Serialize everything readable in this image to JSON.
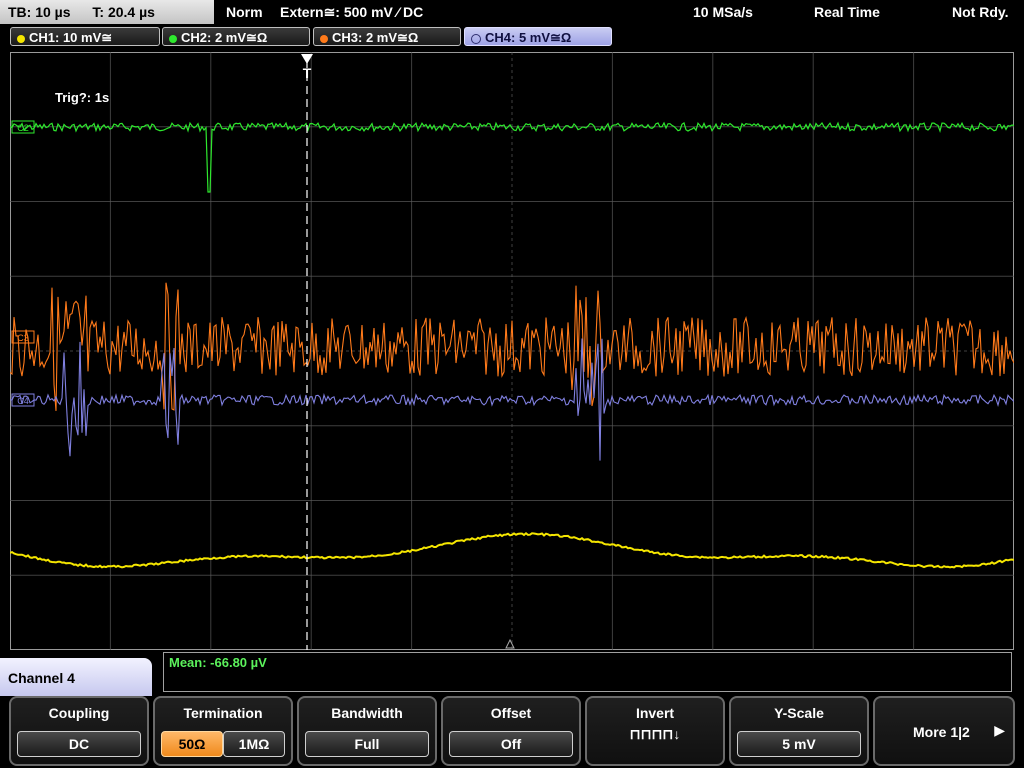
{
  "topbar": {
    "timebase": "TB: 10 µs",
    "trigger_time": "T: 20.4 µs",
    "mode": "Norm",
    "trigger_source": "Extern≅: 500 mV ⁄ DC",
    "sample_rate": "10 MSa/s",
    "acq_mode": "Real Time",
    "status": "Not Rdy."
  },
  "channels": [
    {
      "label": "CH1: 10 mV≅",
      "color": "#f5e600",
      "active": false
    },
    {
      "label": "CH2: 2 mV≅Ω",
      "color": "#2ee82e",
      "active": false
    },
    {
      "label": "CH3: 2 mV≅Ω",
      "color": "#ff7a1a",
      "active": false
    },
    {
      "label": "CH4: 5 mV≅Ω",
      "color": "#8080e0",
      "active": true
    }
  ],
  "screen": {
    "trigger_status": "Trig?: 1s",
    "trigger_marker": "T"
  },
  "measurement": {
    "text": "Mean: -66.80 µV"
  },
  "menu": {
    "channel_title": "Channel 4",
    "softkeys": {
      "coupling": {
        "title": "Coupling",
        "value": "DC"
      },
      "termination": {
        "title": "Termination",
        "option_a": "50Ω",
        "option_b": "1MΩ",
        "selected": "50Ω"
      },
      "bandwidth": {
        "title": "Bandwidth",
        "value": "Full"
      },
      "offset": {
        "title": "Offset",
        "value": "Off"
      },
      "invert": {
        "title": "Invert",
        "glyph": "⊓⊓⊓⊓↓"
      },
      "yscale": {
        "title": "Y-Scale",
        "value": "5 mV"
      },
      "more": {
        "label": "More 1|2",
        "arrow": "▶"
      }
    }
  },
  "colors": {
    "ch1": "#f5e600",
    "ch2": "#2ee82e",
    "ch3": "#ff7a1a",
    "ch4": "#8080e0",
    "grid": "#5a5a5a",
    "trigger_line": "#ffffff"
  },
  "waveform_markers": {
    "ch2": "C2",
    "ch3": "C3",
    "ch4": "C4"
  }
}
